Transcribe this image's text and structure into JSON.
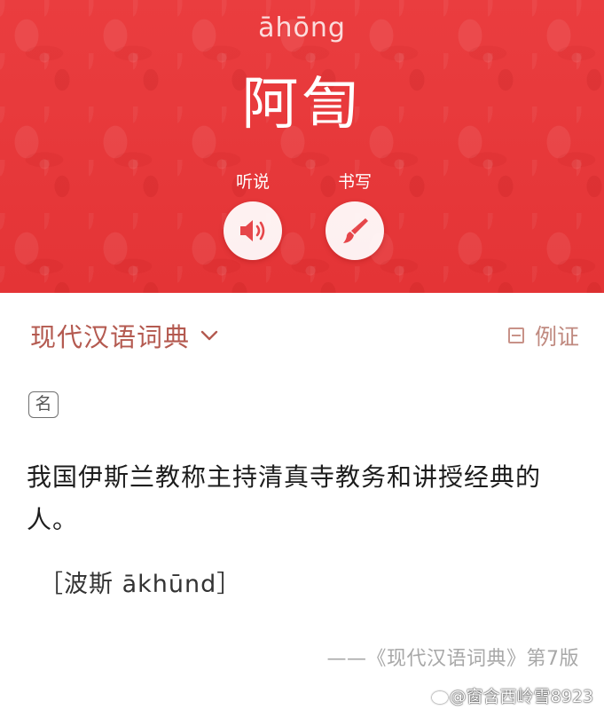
{
  "header": {
    "pinyin": "āhōng",
    "headword": "阿訇",
    "actions": [
      {
        "label": "听说",
        "icon": "speaker-icon"
      },
      {
        "label": "书写",
        "icon": "brush-icon"
      }
    ]
  },
  "dictionary_bar": {
    "dictionary_name": "现代汉语词典",
    "dropdown_icon": "chevron-down-icon",
    "example_label": "例证",
    "example_icon": "collapse-box-icon"
  },
  "entry": {
    "pos_tag": "名",
    "definition": "我国伊斯兰教称主持清真寺教务和讲授经典的人。",
    "etymology": "［波斯 ākhūnd］",
    "source": "——《现代汉语词典》第7版"
  },
  "watermark": {
    "text": "@窗含西岭雪8923",
    "icon": "weibo-icon"
  },
  "colors": {
    "header_red": "#e8393c",
    "dictionary_name": "#b45a50",
    "example_label": "#c08a80",
    "body_text": "#1d1d1d",
    "source_text": "#a8a8a8"
  }
}
